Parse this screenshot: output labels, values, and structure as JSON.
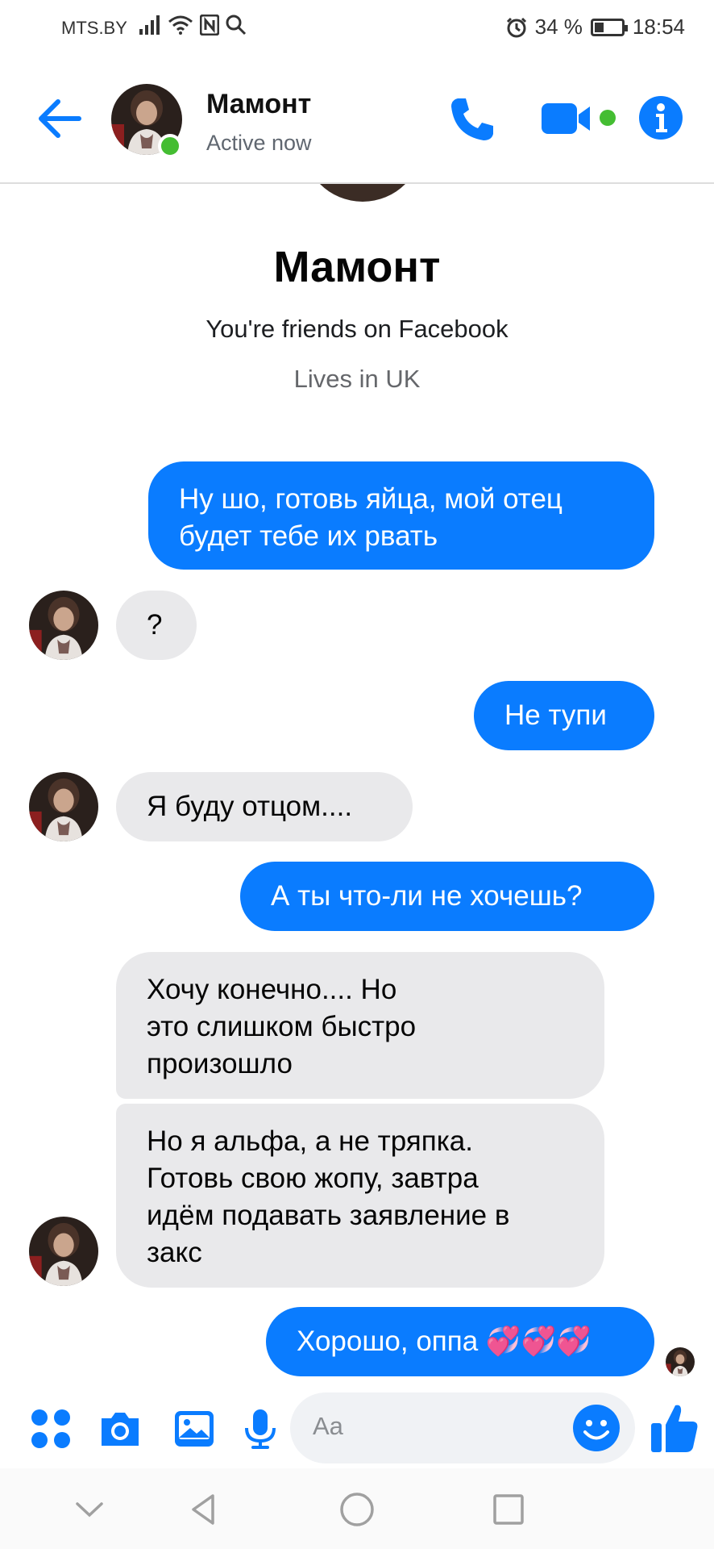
{
  "status_bar": {
    "carrier": "MTS.BY",
    "battery_percent": "34 %",
    "battery_level": 0.34,
    "time": "18:54"
  },
  "header": {
    "contact_name": "Мамонт",
    "active_status": "Active now"
  },
  "profile": {
    "name": "Мамонт",
    "friends_text": "You're friends on Facebook",
    "lives_text": "Lives in UK"
  },
  "messages": [
    {
      "from": "me",
      "lines": [
        "Ну шо, готовь яйца, мой отец",
        "будет тебе их рвать"
      ]
    },
    {
      "from": "them",
      "lines": [
        "?"
      ]
    },
    {
      "from": "me",
      "lines": [
        "Не тупи"
      ]
    },
    {
      "from": "them",
      "lines": [
        "Я буду отцом...."
      ]
    },
    {
      "from": "me",
      "lines": [
        "А ты что-ли не хочешь?"
      ]
    },
    {
      "from": "them",
      "lines": [
        "Хочу конечно.... Но",
        "это слишком быстро",
        "произошло"
      ]
    },
    {
      "from": "them",
      "lines": [
        "Но я альфа, а не тряпка.",
        "Готовь свою жопу, завтра",
        "идём подавать заявление в",
        "закс"
      ]
    },
    {
      "from": "me",
      "lines": [
        "Хорошо, оппа 💞💞💞"
      ]
    }
  ],
  "composer": {
    "placeholder": "Aa"
  },
  "colors": {
    "accent": "#0a7cff",
    "incoming_bubble": "#e9e9eb",
    "online": "#44bd32"
  },
  "icons": [
    "back-arrow-icon",
    "phone-icon",
    "video-camera-icon",
    "info-icon",
    "apps-icon",
    "camera-icon",
    "gallery-icon",
    "microphone-icon",
    "emoji-icon",
    "thumbs-up-icon",
    "nav-back-icon",
    "nav-home-icon",
    "nav-recents-icon",
    "nav-collapse-icon"
  ]
}
